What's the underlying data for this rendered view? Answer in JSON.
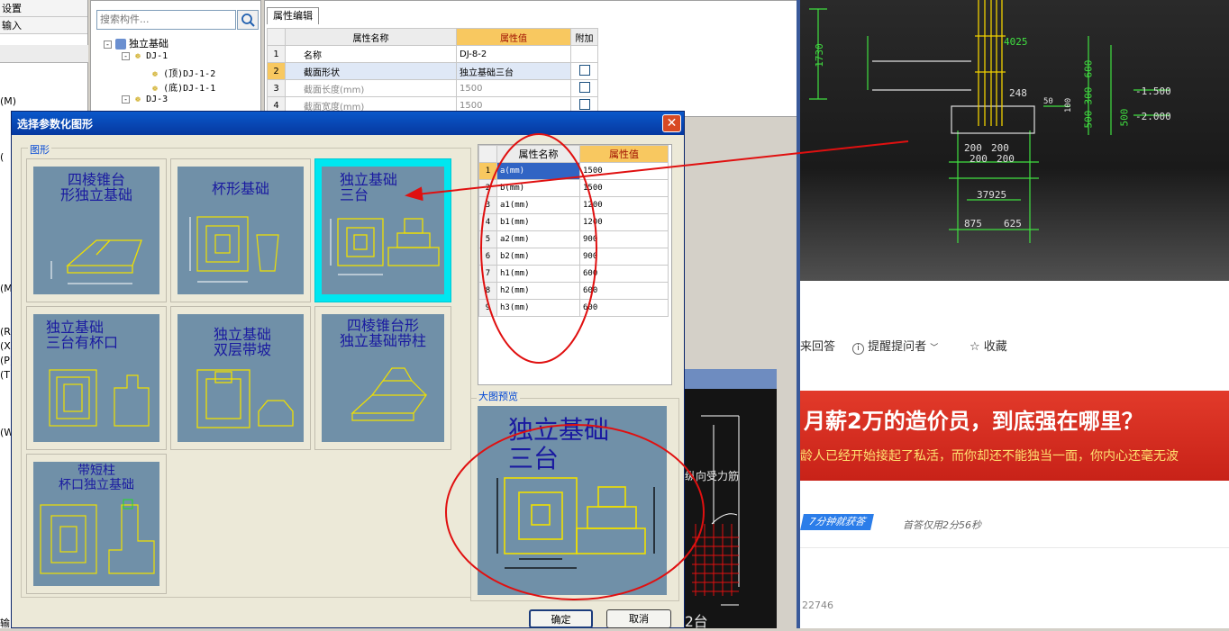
{
  "left_panel": {
    "menu_items": [
      "设置",
      "输入"
    ],
    "side_fragments": [
      "(M)",
      "(",
      "(M)",
      "(R)",
      "(X)",
      "(P)",
      "(T)",
      "(W)",
      "输"
    ]
  },
  "component_tree": {
    "search_placeholder": "搜索构件...",
    "root": "独立基础",
    "items": [
      {
        "label": "DJ-1",
        "level": 1
      },
      {
        "label": "(顶)DJ-1-2",
        "level": 2
      },
      {
        "label": "(底)DJ-1-1",
        "level": 2
      },
      {
        "label": "DJ-3",
        "level": 1
      }
    ]
  },
  "prop_editor": {
    "tab": "属性编辑",
    "headers": [
      "属性名称",
      "属性值",
      "附加"
    ],
    "rows": [
      {
        "no": "1",
        "name": "名称",
        "value": "DJ-8-2",
        "checkbox": false
      },
      {
        "no": "2",
        "name": "截面形状",
        "value": "独立基础三台",
        "checkbox": true
      },
      {
        "no": "3",
        "name": "截面长度(mm)",
        "value": "1500",
        "checkbox": true
      },
      {
        "no": "4",
        "name": "截面宽度(mm)",
        "value": "1500",
        "checkbox": true
      }
    ]
  },
  "dialog": {
    "title": "选择参数化图形",
    "group_label": "图形",
    "shapes": [
      {
        "title_line1": "四棱锥台",
        "title_line2": "形独立基础"
      },
      {
        "title_line1": "杯形基础",
        "title_line2": ""
      },
      {
        "title_line1": "独立基础",
        "title_line2": "三台"
      },
      {
        "title_line1": "独立基础",
        "title_line2": "三台有杯口"
      },
      {
        "title_line1": "独立基础",
        "title_line2": "双层带坡"
      },
      {
        "title_line1": "四棱锥台形",
        "title_line2": "独立基础带柱"
      },
      {
        "title_line1": "带短柱",
        "title_line2": "杯口独立基础"
      }
    ],
    "param_table": {
      "headers": [
        "属性名称",
        "属性值"
      ],
      "rows": [
        {
          "no": "1",
          "name": "a(mm)",
          "value": "1500"
        },
        {
          "no": "2",
          "name": "b(mm)",
          "value": "1500"
        },
        {
          "no": "3",
          "name": "a1(mm)",
          "value": "1200"
        },
        {
          "no": "4",
          "name": "b1(mm)",
          "value": "1200"
        },
        {
          "no": "5",
          "name": "a2(mm)",
          "value": "900"
        },
        {
          "no": "6",
          "name": "b2(mm)",
          "value": "900"
        },
        {
          "no": "7",
          "name": "h1(mm)",
          "value": "600"
        },
        {
          "no": "8",
          "name": "h2(mm)",
          "value": "600"
        },
        {
          "no": "9",
          "name": "h3(mm)",
          "value": "600"
        }
      ]
    },
    "preview_label": "大图预览",
    "preview_title_1": "独立基础",
    "preview_title_2": "三台",
    "ok": "确定",
    "cancel": "取消"
  },
  "cad_top": {
    "dims": [
      "1730",
      "4025",
      "248",
      "600",
      "300",
      "500",
      "500",
      "-1.500",
      "-2.000",
      "200",
      "200",
      "200",
      "200",
      "37925",
      "875",
      "625",
      "50",
      "100"
    ]
  },
  "cad_bottom": {
    "label": "纵向受力筋",
    "bottom_text": "2台"
  },
  "qa": {
    "answer": "来回答",
    "remind": "提醒提问者",
    "favorite": "收藏",
    "banner_title": "月薪2万的造价员，到底强在哪里？",
    "banner_sub": "龄人已经开始接起了私活，而你却还不能独当一面，你内心还毫无波",
    "badge": "7分钟就获答",
    "first_answer": "首答仅用2分56秒",
    "views": "22746"
  },
  "colors": {
    "annotation_red": "#e01010",
    "selected_tile": "#00e6f0",
    "header_orange": "#f8c860"
  }
}
